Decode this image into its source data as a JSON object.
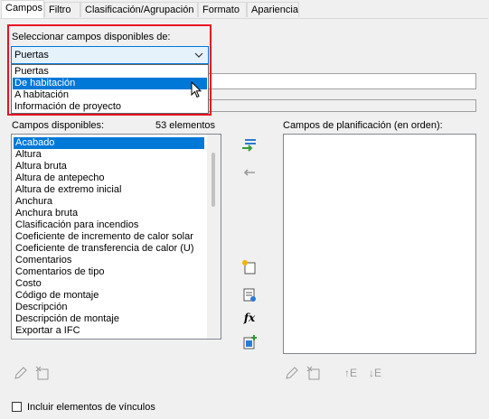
{
  "tabs": [
    {
      "label": "Campos"
    },
    {
      "label": "Filtro"
    },
    {
      "label": "Clasificación/Agrupación"
    },
    {
      "label": "Formato"
    },
    {
      "label": "Apariencia"
    }
  ],
  "select_fields_label": "Seleccionar campos disponibles de:",
  "combo_value": "Puertas",
  "dropdown_options": [
    "Puertas",
    "De habitación",
    "A habitación",
    "Información de proyecto"
  ],
  "available_fields_label": "Campos disponibles:",
  "element_count": "53 elementos",
  "schedule_fields_label": "Campos de planificación (en orden):",
  "available_fields": [
    "Acabado",
    "Altura",
    "Altura bruta",
    "Altura de antepecho",
    "Altura de extremo inicial",
    "Anchura",
    "Anchura bruta",
    "Clasificación para incendios",
    "Coeficiente de incremento de calor solar",
    "Coeficiente de transferencia de calor (U)",
    "Comentarios",
    "Comentarios de tipo",
    "Costo",
    "Código de montaje",
    "Descripción",
    "Descripción de montaje",
    "Exportar a IFC"
  ],
  "include_links_label": "Incluir elementos de vínculos",
  "icons": {
    "add": "add-parameter-icon",
    "remove": "remove-parameter-icon",
    "new_param": "new-parameter-icon",
    "combine": "combine-parameters-icon",
    "calc": "calculated-value-icon",
    "add_all": "add-all-icon",
    "edit": "edit-pencil-icon",
    "delete": "delete-parameter-icon",
    "up": "move-up-icon",
    "down": "move-down-icon"
  },
  "fx_label": "fx",
  "move_up_label": "↑E",
  "move_down_label": "↓E"
}
